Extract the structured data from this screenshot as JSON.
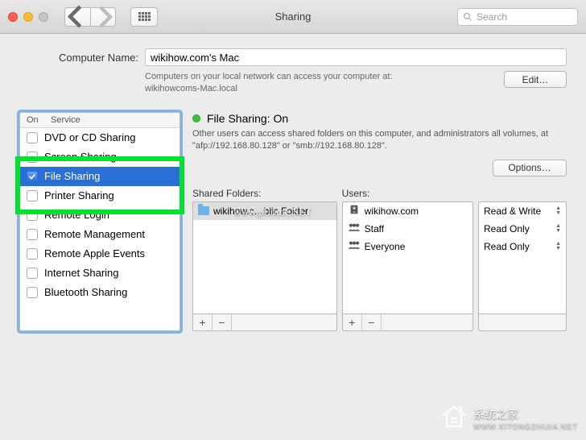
{
  "window": {
    "title": "Sharing",
    "search_placeholder": "Search"
  },
  "computer": {
    "label": "Computer Name:",
    "value": "wikihow.com's Mac",
    "subtext_l1": "Computers on your local network can access your computer at:",
    "subtext_l2": "wikihowcoms-Mac.local",
    "edit": "Edit…"
  },
  "services": {
    "head_on": "On",
    "head_service": "Service",
    "items": [
      {
        "label": "DVD or CD Sharing",
        "on": false
      },
      {
        "label": "Screen Sharing",
        "on": false
      },
      {
        "label": "File Sharing",
        "on": true,
        "selected": true
      },
      {
        "label": "Printer Sharing",
        "on": false
      },
      {
        "label": "Remote Login",
        "on": false
      },
      {
        "label": "Remote Management",
        "on": false
      },
      {
        "label": "Remote Apple Events",
        "on": false
      },
      {
        "label": "Internet Sharing",
        "on": false
      },
      {
        "label": "Bluetooth Sharing",
        "on": false
      }
    ]
  },
  "detail": {
    "status_label": "File Sharing: On",
    "status_desc": "Other users can access shared folders on this computer, and administrators all volumes, at \"afp://192.168.80.128\" or \"smb://192.168.80.128\".",
    "options": "Options…",
    "folders_title": "Shared Folders:",
    "users_title": "Users:",
    "folders": [
      {
        "label": "wikihow.c…blic Folder",
        "selected": true
      }
    ],
    "users": [
      {
        "label": "wikihow.com",
        "type": "single",
        "perm": "Read & Write"
      },
      {
        "label": "Staff",
        "type": "group",
        "perm": "Read Only"
      },
      {
        "label": "Everyone",
        "type": "group",
        "perm": "Read Only"
      }
    ]
  },
  "watermarks": {
    "w1": "www.pHome.NET",
    "w2_cn": "系统之家",
    "w2_url": "WWW.XITONGZHIJIA.NET"
  }
}
